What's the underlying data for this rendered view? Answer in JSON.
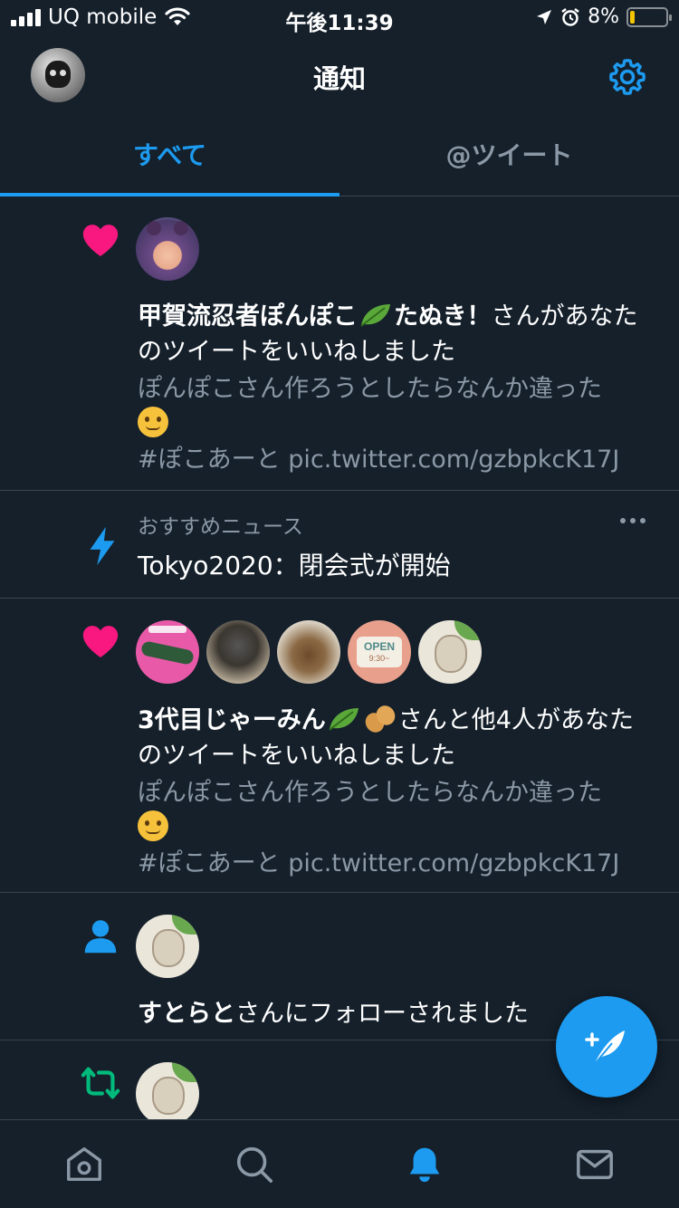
{
  "status_bar": {
    "carrier": "UQ mobile",
    "time": "午後11:39",
    "battery": "8%",
    "battery_level": 0.08
  },
  "header": {
    "title": "通知"
  },
  "tabs": [
    {
      "label": "すべて",
      "active": true
    },
    {
      "label": "@ツイート",
      "active": false
    }
  ],
  "notifications": {
    "like1": {
      "name": "甲賀流忍者ぽんぽこ",
      "name_suffix": "たぬき！",
      "action": "さんがあなたのツイートをいいねしました",
      "tweet_line": "ぽんぽこさん作ろうとしたらなんか違った",
      "tweet_tags": "#ぽこあーと pic.twitter.com/gzbpkcK17J"
    },
    "news": {
      "label": "おすすめニュース",
      "title": "Tokyo2020：閉会式が開始"
    },
    "like2": {
      "name": "3代目じゃーみん",
      "action": "さんと他4人があなたのツイートをいいねしました",
      "tweet_line": "ぽんぽこさん作ろうとしたらなんか違った",
      "tweet_tags": "#ぽこあーと pic.twitter.com/gzbpkcK17J",
      "avatar_sign_text": "OPEN",
      "avatar_sign_hours": "9:30~"
    },
    "follow": {
      "name": "すとらと",
      "action": "さんにフォローされました"
    }
  },
  "colors": {
    "background": "#15202b",
    "accent": "#1d9bf0",
    "like": "#f91880",
    "retweet": "#00ba7c",
    "muted": "#8b98a5"
  },
  "icons": [
    "settings-icon",
    "heart-icon",
    "lightning-icon",
    "person-icon",
    "retweet-icon",
    "home-icon",
    "search-icon",
    "bell-icon",
    "mail-icon",
    "compose-icon",
    "more-icon"
  ]
}
